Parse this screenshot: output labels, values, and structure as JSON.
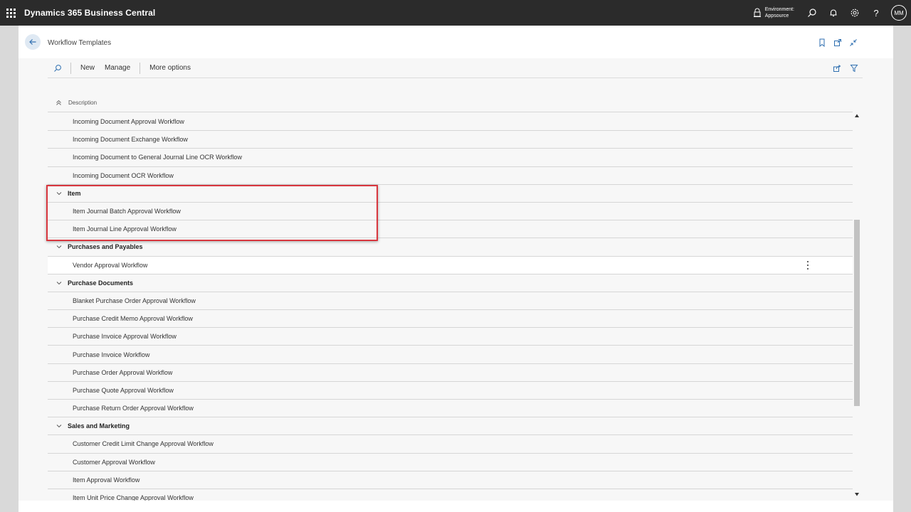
{
  "topbar": {
    "app_title": "Dynamics 365 Business Central",
    "environment_label": "Environment:",
    "environment_name": "Appsource",
    "user_initials": "MM",
    "help_glyph": "?",
    "icons": [
      "waffle-icon",
      "environment-icon",
      "search-icon",
      "bell-icon",
      "gear-icon",
      "help-icon"
    ]
  },
  "page": {
    "title": "Workflow Templates",
    "header_icons": [
      "bookmark-icon",
      "open-new-window-icon",
      "collapse-icon"
    ]
  },
  "actionbar": {
    "new_label": "New",
    "manage_label": "Manage",
    "more_label": "More options",
    "right_icons": [
      "share-icon",
      "filter-icon"
    ]
  },
  "grid": {
    "column_header": "Description",
    "rows": [
      {
        "type": "item",
        "label": "Incoming Document Approval Workflow"
      },
      {
        "type": "item",
        "label": "Incoming Document Exchange Workflow"
      },
      {
        "type": "item",
        "label": "Incoming Document to General Journal Line OCR Workflow"
      },
      {
        "type": "item",
        "label": "Incoming Document OCR Workflow"
      },
      {
        "type": "group",
        "label": "Item"
      },
      {
        "type": "item",
        "label": "Item Journal Batch Approval Workflow"
      },
      {
        "type": "item",
        "label": "Item Journal Line Approval Workflow"
      },
      {
        "type": "group",
        "label": "Purchases and Payables"
      },
      {
        "type": "item",
        "label": "Vendor Approval Workflow",
        "selected": true
      },
      {
        "type": "group",
        "label": "Purchase Documents"
      },
      {
        "type": "item",
        "label": "Blanket Purchase Order Approval Workflow"
      },
      {
        "type": "item",
        "label": "Purchase Credit Memo Approval Workflow"
      },
      {
        "type": "item",
        "label": "Purchase Invoice Approval Workflow"
      },
      {
        "type": "item",
        "label": "Purchase Invoice Workflow"
      },
      {
        "type": "item",
        "label": "Purchase Order Approval Workflow"
      },
      {
        "type": "item",
        "label": "Purchase Quote Approval Workflow"
      },
      {
        "type": "item",
        "label": "Purchase Return Order Approval Workflow"
      },
      {
        "type": "group",
        "label": "Sales and Marketing"
      },
      {
        "type": "item",
        "label": "Customer Credit Limit Change Approval Workflow"
      },
      {
        "type": "item",
        "label": "Customer Approval Workflow"
      },
      {
        "type": "item",
        "label": "Item Approval Workflow"
      },
      {
        "type": "item",
        "label": "Item Unit Price Change Approval Workflow"
      }
    ]
  },
  "annotation": {
    "highlight_color": "#d9363e"
  },
  "colors": {
    "topbar_bg": "#2b2b2b",
    "accent": "#2f6fb0"
  }
}
